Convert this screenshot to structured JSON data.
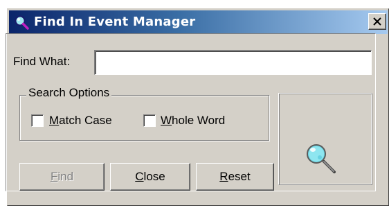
{
  "window": {
    "title": "Find In Event Manager",
    "title_icon": "search-magnifier-icon",
    "close_icon": "close-x-icon",
    "colors": {
      "titlebar_start": "#0a246a",
      "titlebar_end": "#a6caf0",
      "face": "#d4d0c8"
    }
  },
  "find": {
    "label": "Find What:",
    "value": ""
  },
  "search_options": {
    "legend": "Search Options",
    "match_case": {
      "label_hotkey": "M",
      "label_rest": "atch Case",
      "checked": false
    },
    "whole_word": {
      "label_hotkey": "W",
      "label_rest": "hole Word",
      "checked": false
    }
  },
  "buttons": {
    "find": {
      "hotkey": "F",
      "rest": "ind",
      "enabled": false
    },
    "close": {
      "hotkey": "C",
      "rest": "lose",
      "enabled": true
    },
    "reset": {
      "hotkey": "R",
      "rest": "eset",
      "enabled": true
    }
  },
  "preview": {
    "icon": "magnifying-glass-icon"
  }
}
